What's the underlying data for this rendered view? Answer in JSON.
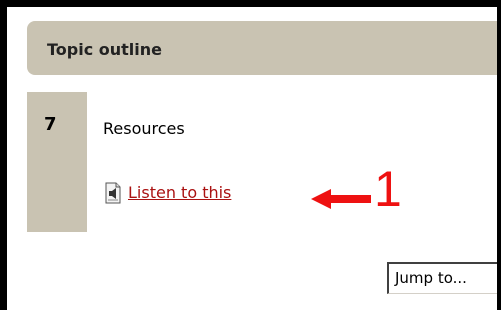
{
  "topic_outline": {
    "title": "Topic outline"
  },
  "section": {
    "number": "7",
    "name": "Resources",
    "resource": {
      "label": "Listen to this",
      "icon": "audio-file-icon"
    }
  },
  "annotation": {
    "number": "1",
    "color": "#ee1111"
  },
  "jump_menu": {
    "value": "Jump to..."
  },
  "colors": {
    "header_bg": "#c9c3b2",
    "link": "#aa1111"
  }
}
